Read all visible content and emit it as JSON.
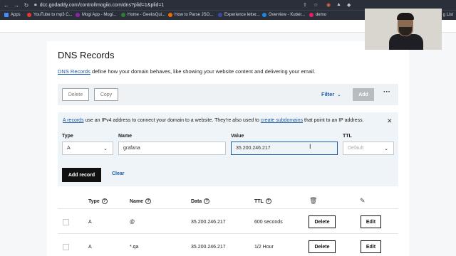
{
  "browser": {
    "url": "dcc.godaddy.com/control/mogiio.com/dns?plid=1&plid=1",
    "bookmarks": [
      {
        "label": "Apps",
        "color": "#4b8bf5"
      },
      {
        "label": "YouTube to mp3 C...",
        "color": "#e53935"
      },
      {
        "label": "Mogi App - Mogi...",
        "color": "#8e24aa"
      },
      {
        "label": "Home - GeeksQui...",
        "color": "#2e7d32"
      },
      {
        "label": "How to Parse JSO...",
        "color": "#ef6c00"
      },
      {
        "label": "Experience letter...",
        "color": "#3949ab"
      },
      {
        "label": "Overview - Kuber...",
        "color": "#1e88e5"
      },
      {
        "label": "demo",
        "color": "#e91e63"
      }
    ],
    "reading_list": "g List"
  },
  "page": {
    "title": "DNS Records",
    "intro_link": "DNS Records",
    "intro_text": " define how your domain behaves, like showing your website content and delivering your email."
  },
  "toolbar": {
    "delete_label": "Delete",
    "copy_label": "Copy",
    "filter_label": "Filter",
    "add_label": "Add",
    "more_label": "···"
  },
  "info": {
    "link1": "A records",
    "text1": " use an IPv4 address to connect your domain to a website. They're also used to ",
    "link2": "create subdomains",
    "text2": " that point to an IP address."
  },
  "form": {
    "type_label": "Type",
    "type_value": "A",
    "name_label": "Name",
    "name_value": "grafana",
    "value_label": "Value",
    "value_value": "35.200.246.217",
    "ttl_label": "TTL",
    "ttl_value": "Default",
    "add_record_label": "Add record",
    "clear_label": "Clear"
  },
  "table": {
    "headers": {
      "type": "Type",
      "name": "Name",
      "data": "Data",
      "ttl": "TTL"
    },
    "rows": [
      {
        "type": "A",
        "name": "@",
        "data": "35.200.246.217",
        "ttl": "600 seconds",
        "delete": "Delete",
        "edit": "Edit"
      },
      {
        "type": "A",
        "name": "*.qa",
        "data": "35.200.246.217",
        "ttl": "1/2 Hour",
        "delete": "Delete",
        "edit": "Edit"
      }
    ]
  },
  "icons": {
    "trash": "trash-icon",
    "pencil": "pencil-icon",
    "help": "help-circle-icon",
    "close": "close-icon",
    "chevron": "chevron-down-icon"
  }
}
